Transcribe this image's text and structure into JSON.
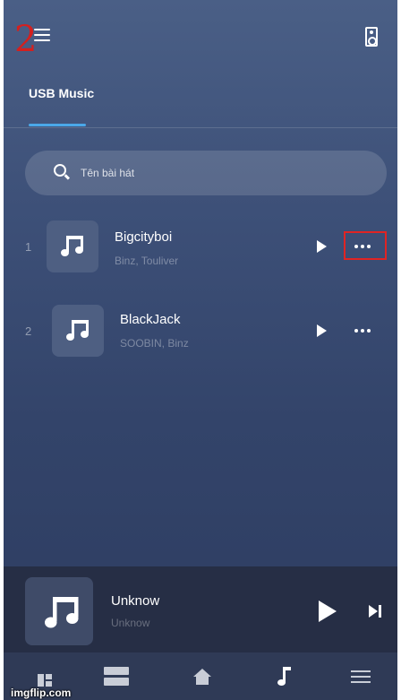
{
  "header": {
    "step_number": "2"
  },
  "tabs": [
    {
      "label": "USB Music",
      "active": true
    }
  ],
  "search": {
    "placeholder": "Tên bài hát"
  },
  "songs": [
    {
      "index": "1",
      "title": "Bigcityboi",
      "artist": "Binz, Touliver"
    },
    {
      "index": "2",
      "title": "BlackJack",
      "artist": "SOOBIN, Binz"
    }
  ],
  "now_playing": {
    "title": "Unknow",
    "artist": "Unknow"
  },
  "bottom_nav": {
    "active": "music",
    "items": [
      "library-icon",
      "playlist-icon",
      "home-icon",
      "music-note-icon",
      "menu-icon"
    ]
  },
  "watermark": "imgflip.com",
  "colors": {
    "accent": "#4aa8e8",
    "highlight": "#e02424",
    "background": "#3d5078"
  }
}
